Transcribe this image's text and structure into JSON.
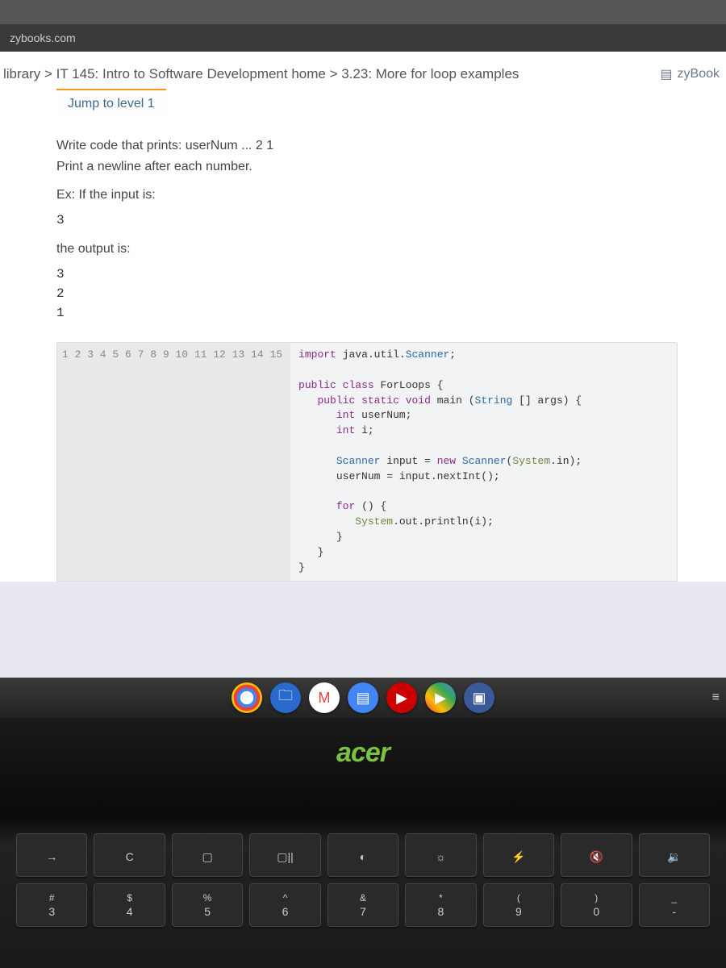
{
  "url": "zybooks.com",
  "breadcrumb": "library > IT 145: Intro to Software Development home > 3.23: More for loop examples",
  "zybooks_link": "zyBook",
  "jump_tab": "Jump to level 1",
  "prompt": {
    "line1": "Write code that prints: userNum ... 2 1",
    "line2": "Print a newline after each number.",
    "ex_label": "Ex: If the input is:",
    "input_val": "3",
    "out_label": "the output is:",
    "output": "3\n2\n1"
  },
  "code": {
    "lines": [
      "import java.util.Scanner;",
      "",
      "public class ForLoops {",
      "   public static void main (String [] args) {",
      "      int userNum;",
      "      int i;",
      "",
      "      Scanner input = new Scanner(System.in);",
      "      userNum = input.nextInt();",
      "",
      "      for () {",
      "         System.out.println(i);",
      "      }",
      "   }",
      "}"
    ],
    "line_numbers": [
      "1",
      "2",
      "3",
      "4",
      "5",
      "6",
      "7",
      "8",
      "9",
      "10",
      "11",
      "12",
      "13",
      "14",
      "15"
    ]
  },
  "laptop_brand": "acer",
  "keys_row1": [
    {
      "top": "",
      "bot": "→"
    },
    {
      "top": "",
      "bot": "C"
    },
    {
      "top": "",
      "bot": "▢"
    },
    {
      "top": "",
      "bot": "▢||"
    },
    {
      "top": "",
      "bot": "◐"
    },
    {
      "top": "",
      "bot": "☼"
    },
    {
      "top": "",
      "bot": "⚡"
    },
    {
      "top": "",
      "bot": "🔇"
    },
    {
      "top": "",
      "bot": "🔉"
    }
  ],
  "keys_row2": [
    {
      "top": "#",
      "bot": "3"
    },
    {
      "top": "$",
      "bot": "4"
    },
    {
      "top": "%",
      "bot": "5"
    },
    {
      "top": "^",
      "bot": "6"
    },
    {
      "top": "&",
      "bot": "7"
    },
    {
      "top": "*",
      "bot": "8"
    },
    {
      "top": "(",
      "bot": "9"
    },
    {
      "top": ")",
      "bot": "0"
    },
    {
      "top": "_",
      "bot": "-"
    }
  ]
}
